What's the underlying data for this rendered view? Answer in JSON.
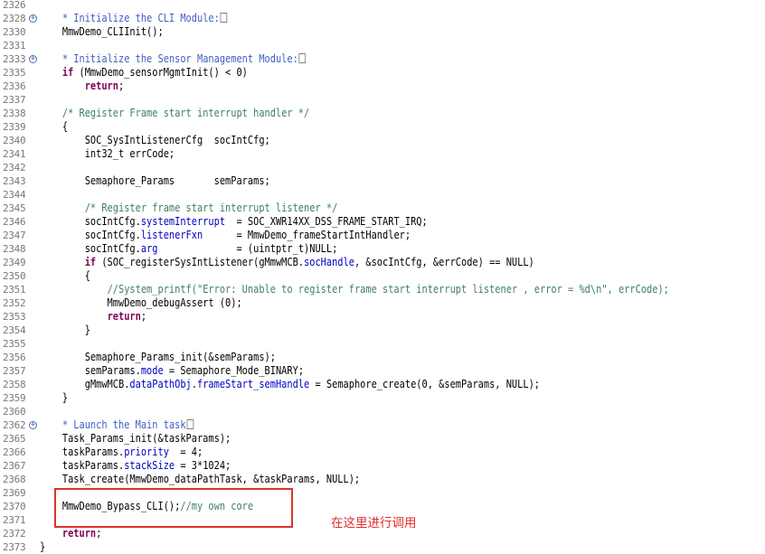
{
  "editor": {
    "lines": [
      {
        "num": "2326",
        "fold": false,
        "segments": []
      },
      {
        "num": "2328",
        "fold": true,
        "segments": [
          {
            "t": "    ",
            "c": ""
          },
          {
            "t": "* Initialize the CLI Module:",
            "c": "dc"
          },
          {
            "t": "",
            "c": "box"
          }
        ]
      },
      {
        "num": "2330",
        "fold": false,
        "segments": [
          {
            "t": "    MmwDemo_CLIInit();",
            "c": ""
          }
        ]
      },
      {
        "num": "2331",
        "fold": false,
        "segments": []
      },
      {
        "num": "2333",
        "fold": true,
        "segments": [
          {
            "t": "    ",
            "c": ""
          },
          {
            "t": "* Initialize the Sensor Management Module:",
            "c": "dc"
          },
          {
            "t": "",
            "c": "box"
          }
        ]
      },
      {
        "num": "2335",
        "fold": false,
        "segments": [
          {
            "t": "    ",
            "c": ""
          },
          {
            "t": "if",
            "c": "k"
          },
          {
            "t": " (MmwDemo_sensorMgmtInit() < 0)",
            "c": ""
          }
        ]
      },
      {
        "num": "2336",
        "fold": false,
        "segments": [
          {
            "t": "        ",
            "c": ""
          },
          {
            "t": "return",
            "c": "k"
          },
          {
            "t": ";",
            "c": ""
          }
        ]
      },
      {
        "num": "2337",
        "fold": false,
        "segments": []
      },
      {
        "num": "2338",
        "fold": false,
        "segments": [
          {
            "t": "    ",
            "c": ""
          },
          {
            "t": "/* Register Frame start interrupt handler */",
            "c": "c"
          }
        ]
      },
      {
        "num": "2339",
        "fold": false,
        "segments": [
          {
            "t": "    {",
            "c": ""
          }
        ]
      },
      {
        "num": "2340",
        "fold": false,
        "segments": [
          {
            "t": "        SOC_SysIntListenerCfg  socIntCfg;",
            "c": ""
          }
        ]
      },
      {
        "num": "2341",
        "fold": false,
        "segments": [
          {
            "t": "        int32_t errCode;",
            "c": ""
          }
        ]
      },
      {
        "num": "2342",
        "fold": false,
        "segments": []
      },
      {
        "num": "2343",
        "fold": false,
        "segments": [
          {
            "t": "        Semaphore_Params       semParams;",
            "c": ""
          }
        ]
      },
      {
        "num": "2344",
        "fold": false,
        "segments": []
      },
      {
        "num": "2345",
        "fold": false,
        "segments": [
          {
            "t": "        ",
            "c": ""
          },
          {
            "t": "/* Register frame start interrupt listener */",
            "c": "c"
          }
        ]
      },
      {
        "num": "2346",
        "fold": false,
        "segments": [
          {
            "t": "        socIntCfg.",
            "c": ""
          },
          {
            "t": "systemInterrupt",
            "c": "f"
          },
          {
            "t": "  = SOC_XWR14XX_DSS_FRAME_START_IRQ;",
            "c": ""
          }
        ]
      },
      {
        "num": "2347",
        "fold": false,
        "segments": [
          {
            "t": "        socIntCfg.",
            "c": ""
          },
          {
            "t": "listenerFxn",
            "c": "f"
          },
          {
            "t": "      = MmwDemo_frameStartIntHandler;",
            "c": ""
          }
        ]
      },
      {
        "num": "2348",
        "fold": false,
        "segments": [
          {
            "t": "        socIntCfg.",
            "c": ""
          },
          {
            "t": "arg",
            "c": "f"
          },
          {
            "t": "              = (uintptr_t)NULL;",
            "c": ""
          }
        ]
      },
      {
        "num": "2349",
        "fold": false,
        "segments": [
          {
            "t": "        ",
            "c": ""
          },
          {
            "t": "if",
            "c": "k"
          },
          {
            "t": " (SOC_registerSysIntListener(gMmwMCB.",
            "c": ""
          },
          {
            "t": "socHandle",
            "c": "f"
          },
          {
            "t": ", &socIntCfg, &errCode) == NULL)",
            "c": ""
          }
        ]
      },
      {
        "num": "2350",
        "fold": false,
        "segments": [
          {
            "t": "        {",
            "c": ""
          }
        ]
      },
      {
        "num": "2351",
        "fold": false,
        "segments": [
          {
            "t": "            ",
            "c": ""
          },
          {
            "t": "//System_printf(\"Error: Unable to register frame start interrupt listener , error = %d\\n\", errCode);",
            "c": "c"
          }
        ]
      },
      {
        "num": "2352",
        "fold": false,
        "segments": [
          {
            "t": "            MmwDemo_debugAssert (0);",
            "c": ""
          }
        ]
      },
      {
        "num": "2353",
        "fold": false,
        "segments": [
          {
            "t": "            ",
            "c": ""
          },
          {
            "t": "return",
            "c": "k"
          },
          {
            "t": ";",
            "c": ""
          }
        ]
      },
      {
        "num": "2354",
        "fold": false,
        "segments": [
          {
            "t": "        }",
            "c": ""
          }
        ]
      },
      {
        "num": "2355",
        "fold": false,
        "segments": []
      },
      {
        "num": "2356",
        "fold": false,
        "segments": [
          {
            "t": "        Semaphore_Params_init(&semParams);",
            "c": ""
          }
        ]
      },
      {
        "num": "2357",
        "fold": false,
        "segments": [
          {
            "t": "        semParams.",
            "c": ""
          },
          {
            "t": "mode",
            "c": "f"
          },
          {
            "t": " = Semaphore_Mode_BINARY;",
            "c": ""
          }
        ]
      },
      {
        "num": "2358",
        "fold": false,
        "segments": [
          {
            "t": "        gMmwMCB.",
            "c": ""
          },
          {
            "t": "dataPathObj",
            "c": "f"
          },
          {
            "t": ".",
            "c": ""
          },
          {
            "t": "frameStart_semHandle",
            "c": "f"
          },
          {
            "t": " = Semaphore_create(0, &semParams, NULL);",
            "c": ""
          }
        ]
      },
      {
        "num": "2359",
        "fold": false,
        "segments": [
          {
            "t": "    }",
            "c": ""
          }
        ]
      },
      {
        "num": "2360",
        "fold": false,
        "segments": []
      },
      {
        "num": "2362",
        "fold": true,
        "segments": [
          {
            "t": "    ",
            "c": ""
          },
          {
            "t": "* Launch the Main task",
            "c": "dc"
          },
          {
            "t": "",
            "c": "box"
          }
        ]
      },
      {
        "num": "2365",
        "fold": false,
        "segments": [
          {
            "t": "    Task_Params_init(&taskParams);",
            "c": ""
          }
        ]
      },
      {
        "num": "2366",
        "fold": false,
        "segments": [
          {
            "t": "    taskParams.",
            "c": ""
          },
          {
            "t": "priority",
            "c": "f"
          },
          {
            "t": "  = 4;",
            "c": ""
          }
        ]
      },
      {
        "num": "2367",
        "fold": false,
        "segments": [
          {
            "t": "    taskParams.",
            "c": ""
          },
          {
            "t": "stackSize",
            "c": "f"
          },
          {
            "t": " = 3*1024;",
            "c": ""
          }
        ]
      },
      {
        "num": "2368",
        "fold": false,
        "segments": [
          {
            "t": "    Task_create(MmwDemo_dataPathTask, &taskParams, NULL);",
            "c": ""
          }
        ]
      },
      {
        "num": "2369",
        "fold": false,
        "segments": []
      },
      {
        "num": "2370",
        "fold": false,
        "segments": [
          {
            "t": "    MmwDemo_Bypass_CLI();",
            "c": ""
          },
          {
            "t": "//my own core",
            "c": "c"
          }
        ]
      },
      {
        "num": "2371",
        "fold": false,
        "segments": []
      },
      {
        "num": "2372",
        "fold": false,
        "segments": [
          {
            "t": "    ",
            "c": ""
          },
          {
            "t": "return",
            "c": "k"
          },
          {
            "t": ";",
            "c": ""
          }
        ]
      },
      {
        "num": "2373",
        "fold": false,
        "segments": [
          {
            "t": "}",
            "c": ""
          }
        ]
      }
    ]
  },
  "annotation": {
    "text": "在这里进行调用",
    "color": "#e0312f"
  }
}
